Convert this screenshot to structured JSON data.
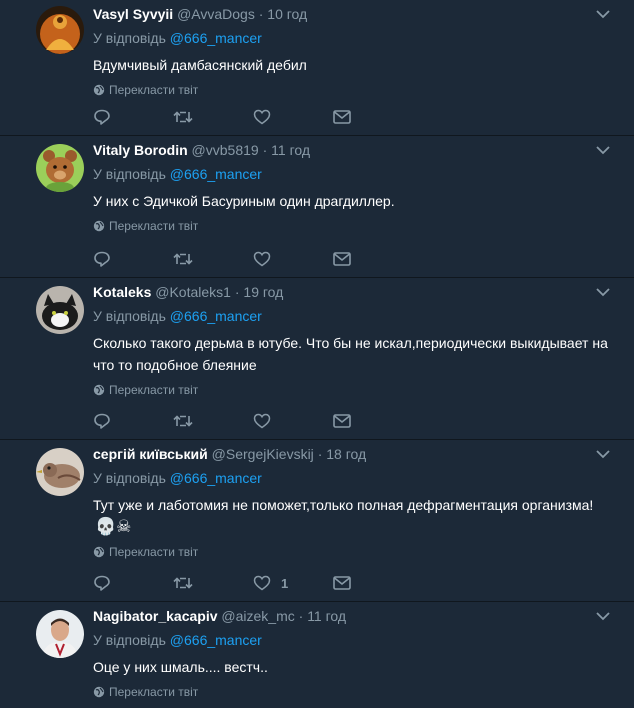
{
  "ui": {
    "reply_prefix": "У відповідь",
    "translate_label": "Перекласти твіт",
    "colors": {
      "background": "#1c2938",
      "accent": "#1da1f2",
      "muted": "#8899a6"
    }
  },
  "tweets": [
    {
      "name": "Vasyl Syvyii",
      "handle": "@AvvaDogs",
      "time": "10 год",
      "mention": "@666_mancer",
      "text": "Вдумчивый дамбасянский дебил",
      "likes": "",
      "avatar": "buddha-figure"
    },
    {
      "name": "Vitaly Borodin",
      "handle": "@vvb5819",
      "time": "11 год",
      "mention": "@666_mancer",
      "text": "У них с Эдичкой Басуриным один драгдиллер.",
      "likes": "",
      "avatar": "teddy-bear"
    },
    {
      "name": "Kotaleks",
      "handle": "@Kotaleks1",
      "time": "19 год",
      "mention": "@666_mancer",
      "text": "Сколько такого дерьма в ютубе. Что бы не искал,периодически выкидывает на что то  подобное блеяние",
      "likes": "",
      "avatar": "cat"
    },
    {
      "name": "сергій київський",
      "handle": "@SergejKievskij",
      "time": "18 год",
      "mention": "@666_mancer",
      "text": "Тут уже и лаботомия не поможет,только полная дефрагментация организма!",
      "emoji": "💀☠",
      "likes": "1",
      "avatar": "bird"
    },
    {
      "name": "Nagibator_kacapiv",
      "handle": "@aizek_mc",
      "time": "11 год",
      "mention": "@666_mancer",
      "text": "Оце у них шмаль.... вестч..",
      "likes": "",
      "avatar": "man-portrait"
    }
  ]
}
